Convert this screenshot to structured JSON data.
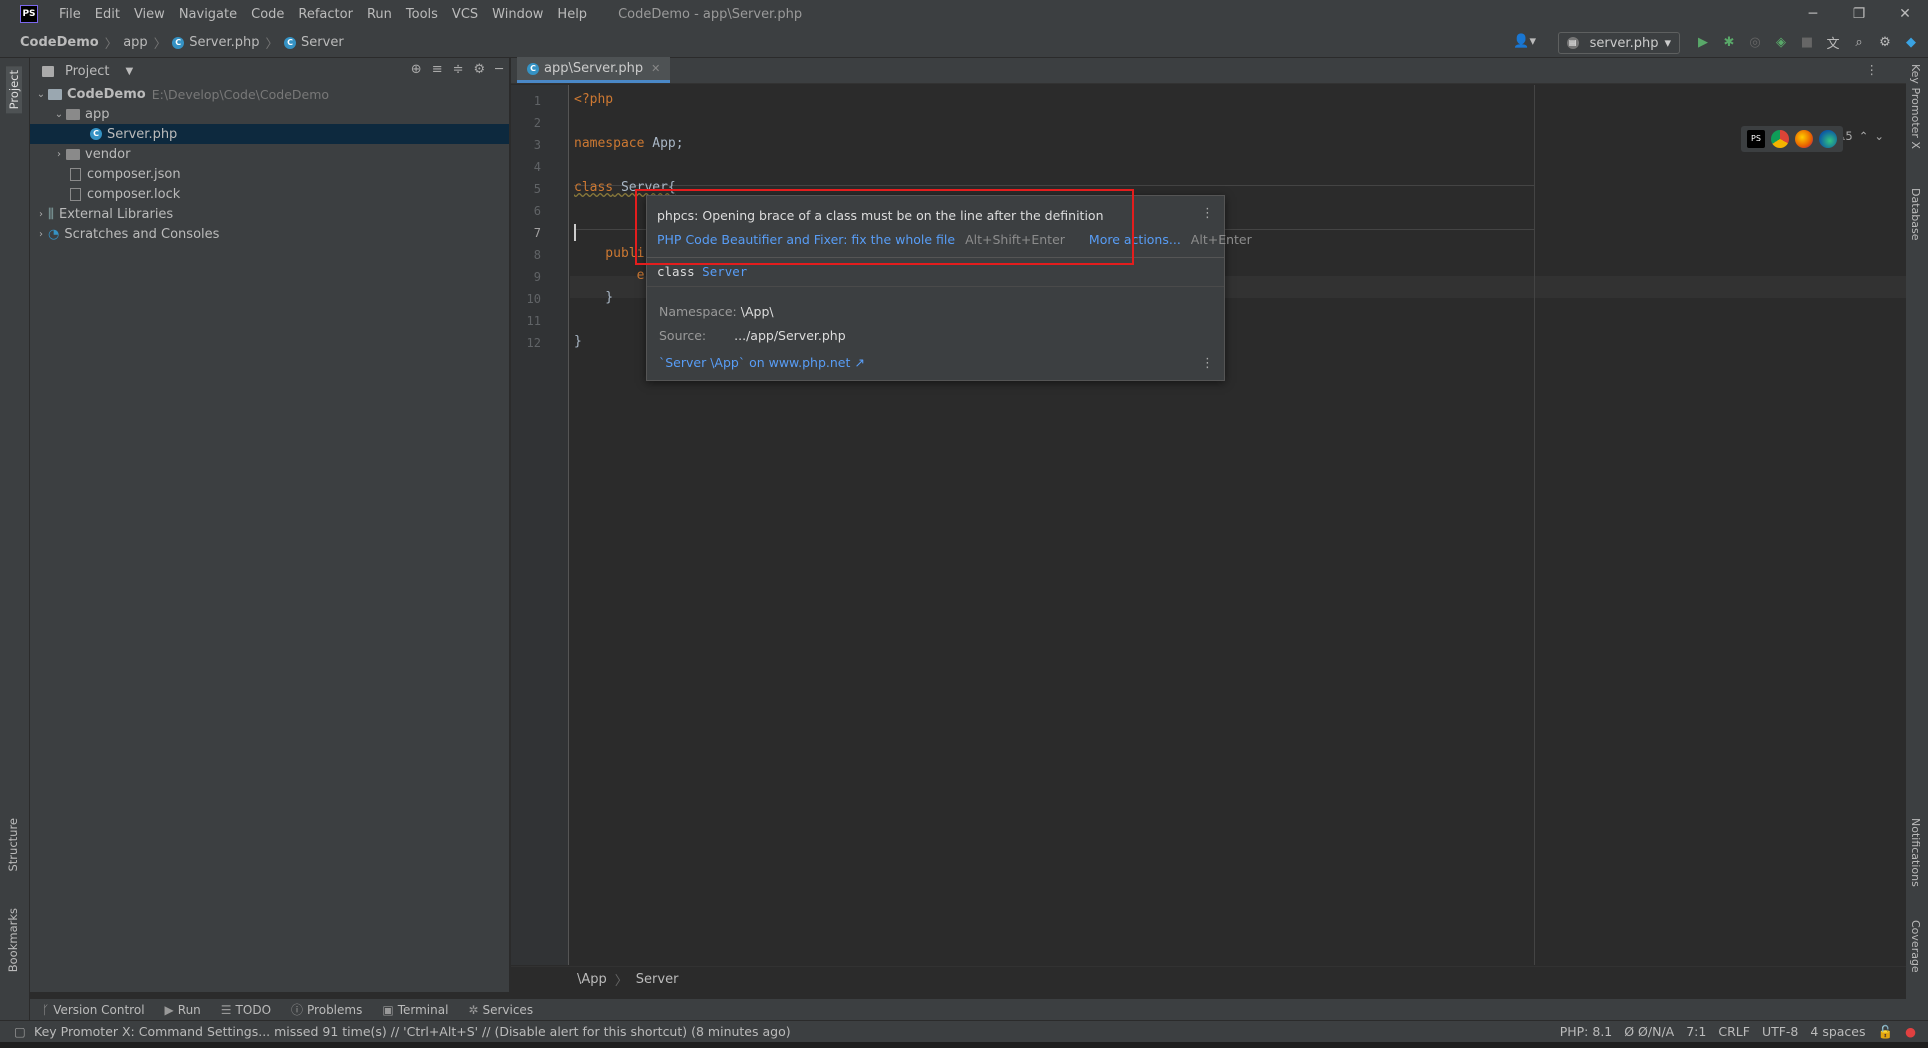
{
  "titlebar": {
    "logo": "PS",
    "menu": [
      "File",
      "Edit",
      "View",
      "Navigate",
      "Code",
      "Refactor",
      "Run",
      "Tools",
      "VCS",
      "Window",
      "Help"
    ],
    "title": "CodeDemo - app\\Server.php"
  },
  "navbar": {
    "crumbs": [
      "CodeDemo",
      "app",
      "Server.php",
      "Server"
    ],
    "run_config": "server.php"
  },
  "left_tabs": [
    "Project",
    "Structure",
    "Bookmarks"
  ],
  "right_tabs": [
    "Key Promoter X",
    "Database",
    "Notifications",
    "Coverage"
  ],
  "project": {
    "header": "Project",
    "tree": [
      {
        "label": "CodeDemo",
        "path": "E:\\Develop\\Code\\CodeDemo"
      },
      {
        "label": "app"
      },
      {
        "label": "Server.php"
      },
      {
        "label": "vendor"
      },
      {
        "label": "composer.json"
      },
      {
        "label": "composer.lock"
      },
      {
        "label": "External Libraries"
      },
      {
        "label": "Scratches and Consoles"
      }
    ]
  },
  "editor": {
    "tab": "app\\Server.php",
    "line_numbers": [
      "1",
      "2",
      "3",
      "4",
      "5",
      "6",
      "7",
      "8",
      "9",
      "10",
      "11",
      "12"
    ],
    "code": {
      "l1": "<?php",
      "l3_kw": "namespace",
      "l3_rest": " App;",
      "l5_kw": "class",
      "l5_rest": " Server{",
      "l8": "    publi",
      "l9": "        e",
      "l10": "    }",
      "l12": "}"
    },
    "inspections": "⚠5",
    "breadcrumb": [
      "\\App",
      "Server"
    ]
  },
  "popup": {
    "message": "phpcs: Opening brace of a class must be on the line after the definition",
    "fix_action": "PHP Code Beautifier and Fixer: fix the whole file",
    "fix_shortcut": "Alt+Shift+Enter",
    "more_actions": "More actions...",
    "more_shortcut": "Alt+Enter",
    "class_kw": "class",
    "class_name": "Server",
    "namespace_label": "Namespace:",
    "namespace_value": "\\App\\",
    "source_label": "Source:",
    "source_value": ".../app/Server.php",
    "doc_link": "`Server \\App` on www.php.net ↗"
  },
  "toolwindows": [
    "Version Control",
    "Run",
    "TODO",
    "Problems",
    "Terminal",
    "Services"
  ],
  "status": {
    "message": "Key Promoter X: Command Settings... missed 91 time(s) // 'Ctrl+Alt+S' // (Disable alert for this shortcut) (8 minutes ago)",
    "php": "PHP: 8.1",
    "vcs": "Ø Ø/N/A",
    "position": "7:1",
    "line_sep": "CRLF",
    "encoding": "UTF-8",
    "indent": "4 spaces"
  },
  "colors": {
    "accent": "#4a88c7",
    "highlight_box": "#e41d1d",
    "keyword": "#cc7832",
    "link": "#589df6"
  }
}
